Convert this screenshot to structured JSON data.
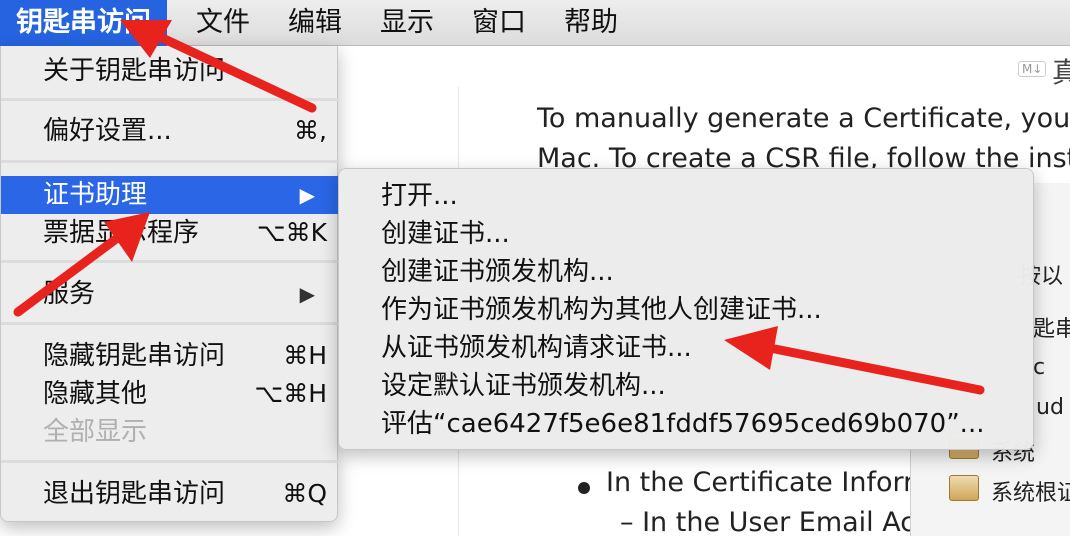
{
  "menubar": {
    "app_menu": "钥匙串访问",
    "file": "文件",
    "edit": "编辑",
    "view": "显示",
    "window": "窗口",
    "help": "帮助"
  },
  "app_menu": {
    "about": "关于钥匙串访问",
    "preferences": "偏好设置...",
    "preferences_shortcut": "⌘,",
    "cert_assistant": "证书助理",
    "cert_assistant_arrow": "▶",
    "ticket_viewer": "票据显示程序",
    "ticket_viewer_shortcut": "⌥⌘K",
    "services": "服务",
    "services_arrow": "▶",
    "hide": "隐藏钥匙串访问",
    "hide_shortcut": "⌘H",
    "hide_others": "隐藏其他",
    "hide_others_shortcut": "⌥⌘H",
    "show_all": "全部显示",
    "quit": "退出钥匙串访问",
    "quit_shortcut": "⌘Q"
  },
  "submenu": {
    "open": "打开...",
    "create_cert": "创建证书...",
    "create_ca": "创建证书颁发机构...",
    "create_cert_for_others": "作为证书颁发机构为其他人创建证书...",
    "request_from_ca": "从证书颁发机构请求证书...",
    "set_default_ca": "设定默认证书颁发机构...",
    "evaluate": "评估“cae6427f5e6e81fddf57695ced69b070”..."
  },
  "document": {
    "md_badge": "M↓",
    "title_fragment": "真",
    "line1": "To manually generate a Certificate, you n",
    "line2": "Mac. To create a CSR file, follow the instr",
    "bullet1": "In the Certificate Inforr",
    "sub1": "– In the User Email Ac"
  },
  "keychain_panel": {
    "frag1": "按以",
    "frag2": "匙串",
    "frag3": "c",
    "frag4": "ud",
    "system": "系统",
    "system_roots": "系统根证"
  },
  "colors": {
    "highlight": "#2a66e6",
    "arrow": "#e8231e"
  }
}
